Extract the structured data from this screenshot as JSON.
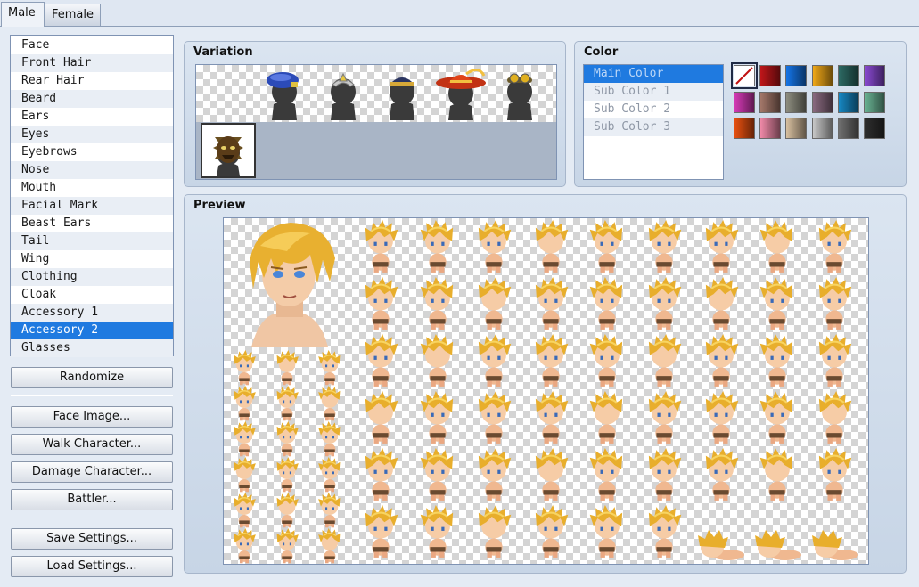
{
  "tabs": [
    {
      "label": "Male",
      "active": true
    },
    {
      "label": "Female",
      "active": false
    }
  ],
  "parts": {
    "items": [
      "Face",
      "Front Hair",
      "Rear Hair",
      "Beard",
      "Ears",
      "Eyes",
      "Eyebrows",
      "Nose",
      "Mouth",
      "Facial Mark",
      "Beast Ears",
      "Tail",
      "Wing",
      "Clothing",
      "Cloak",
      "Accessory 1",
      "Accessory 2",
      "Glasses"
    ],
    "selected_index": 16
  },
  "buttons": {
    "randomize": "Randomize",
    "face_image": "Face Image...",
    "walk_character": "Walk Character...",
    "damage_character": "Damage Character...",
    "battler": "Battler...",
    "save_settings": "Save Settings...",
    "load_settings": "Load Settings..."
  },
  "variation": {
    "title": "Variation",
    "items": [
      "none",
      "blue-beret",
      "silver-tiara",
      "navy-cap",
      "red-feathered-hat",
      "goggles",
      "tribal-mask"
    ],
    "selected_index": 6
  },
  "color": {
    "title": "Color",
    "items": [
      "Main Color",
      "Sub Color 1",
      "Sub Color 2",
      "Sub Color 3"
    ],
    "selected_index": 0,
    "swatches": [
      [
        "none",
        "#c0161a",
        "#1575e8",
        "#f0a818",
        "#2d6a64",
        "#8a4ad2"
      ],
      [
        "#d53ab6",
        "#a4786a",
        "#8e8e80",
        "#8a6a80",
        "#1788c4",
        "#6ab494"
      ],
      [
        "#e85010",
        "#f08aa8",
        "#d8c0a0",
        "#c8c8c8",
        "#707070",
        "#2e2e2e"
      ]
    ],
    "selected_swatch": "none"
  },
  "preview": {
    "title": "Preview"
  }
}
